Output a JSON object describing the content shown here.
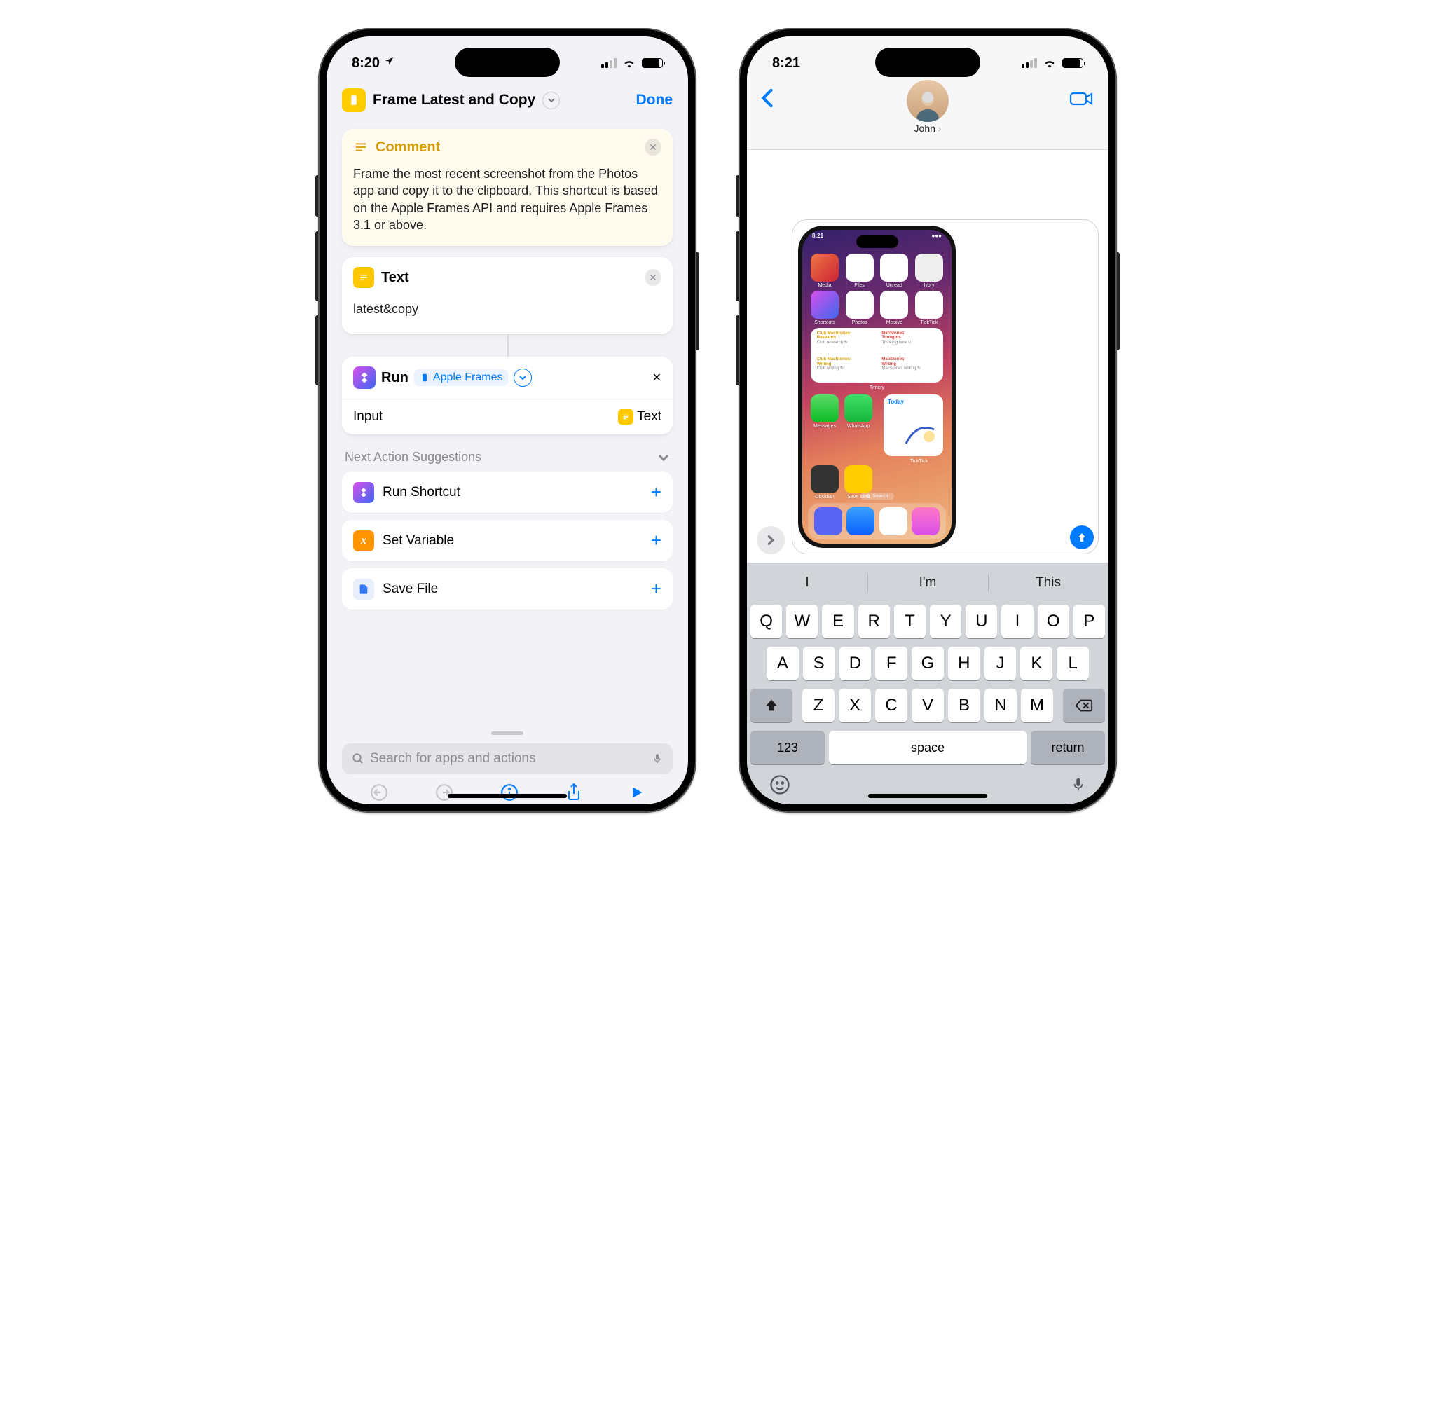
{
  "left": {
    "status_time": "8:20",
    "nav": {
      "title": "Frame Latest and Copy",
      "done": "Done"
    },
    "comment": {
      "header": "Comment",
      "body": "Frame the most recent screenshot from the Photos app and copy it to the clipboard. This shortcut is based on the Apple Frames API and requires Apple Frames 3.1 or above."
    },
    "text": {
      "header": "Text",
      "value": "latest&copy"
    },
    "run": {
      "label": "Run",
      "shortcut_name": "Apple Frames",
      "input_label": "Input",
      "input_value": "Text"
    },
    "suggestions": {
      "header": "Next Action Suggestions",
      "items": [
        {
          "label": "Run Shortcut",
          "icon": "shortcuts",
          "color": "linear-gradient(135deg,#d94fea,#3c68f0)"
        },
        {
          "label": "Set Variable",
          "icon": "variable",
          "color": "#ff9500"
        },
        {
          "label": "Save File",
          "icon": "file",
          "color": "#e9effa"
        }
      ]
    },
    "search_placeholder": "Search for apps and actions"
  },
  "right": {
    "status_time": "8:21",
    "contact_name": "John",
    "predictions": [
      "I",
      "I'm",
      "This"
    ],
    "keyboard": {
      "row1": [
        "Q",
        "W",
        "E",
        "R",
        "T",
        "Y",
        "U",
        "I",
        "O",
        "P"
      ],
      "row2": [
        "A",
        "S",
        "D",
        "F",
        "G",
        "H",
        "J",
        "K",
        "L"
      ],
      "row3": [
        "Z",
        "X",
        "C",
        "V",
        "B",
        "N",
        "M"
      ],
      "num": "123",
      "space": "space",
      "return": "return"
    },
    "mini": {
      "status_time": "8:21",
      "apps_row1": [
        {
          "name": "Media",
          "color": "linear-gradient(135deg,#e74,#c23)"
        },
        {
          "name": "Files",
          "color": "#fff"
        },
        {
          "name": "Unread",
          "color": "#fff"
        },
        {
          "name": "Ivory",
          "color": "#eee"
        }
      ],
      "apps_row2": [
        {
          "name": "Shortcuts",
          "color": "linear-gradient(135deg,#d94fea,#3c68f0)"
        },
        {
          "name": "Photos",
          "color": "#fff"
        },
        {
          "name": "Missive",
          "color": "#fff"
        },
        {
          "name": "TickTick",
          "color": "#fff"
        }
      ],
      "timery": [
        {
          "heading": "Club MacStories:",
          "heading2": "Research",
          "sub": "Club research",
          "cls": ""
        },
        {
          "heading": "MacStories:",
          "heading2": "Thoughts",
          "sub": "Thinking time",
          "cls": "red"
        },
        {
          "heading": "Club MacStories:",
          "heading2": "Writing",
          "sub": "Club writing",
          "cls": ""
        },
        {
          "heading": "MacStories:",
          "heading2": "Writing",
          "sub": "MacStories writing",
          "cls": "red"
        }
      ],
      "timery_label": "Timery",
      "apps_row3": [
        {
          "name": "Messages",
          "color": "linear-gradient(#5ddb68,#0bbb23)"
        },
        {
          "name": "WhatsApp",
          "color": "linear-gradient(#3fe069,#17b53a)"
        }
      ],
      "today_label": "Today",
      "ticktick_label": "TickTick",
      "apps_row4": [
        {
          "name": "Obsidian",
          "color": "#333"
        },
        {
          "name": "Save Idea",
          "color": "#ffcc00"
        }
      ],
      "search_label": "Search",
      "dock": [
        {
          "color": "#5865f2"
        },
        {
          "color": "linear-gradient(#3aa0ff,#0a60ff)"
        },
        {
          "color": "#fff"
        },
        {
          "color": "linear-gradient(#ff77c6,#d84fea)"
        }
      ]
    }
  }
}
